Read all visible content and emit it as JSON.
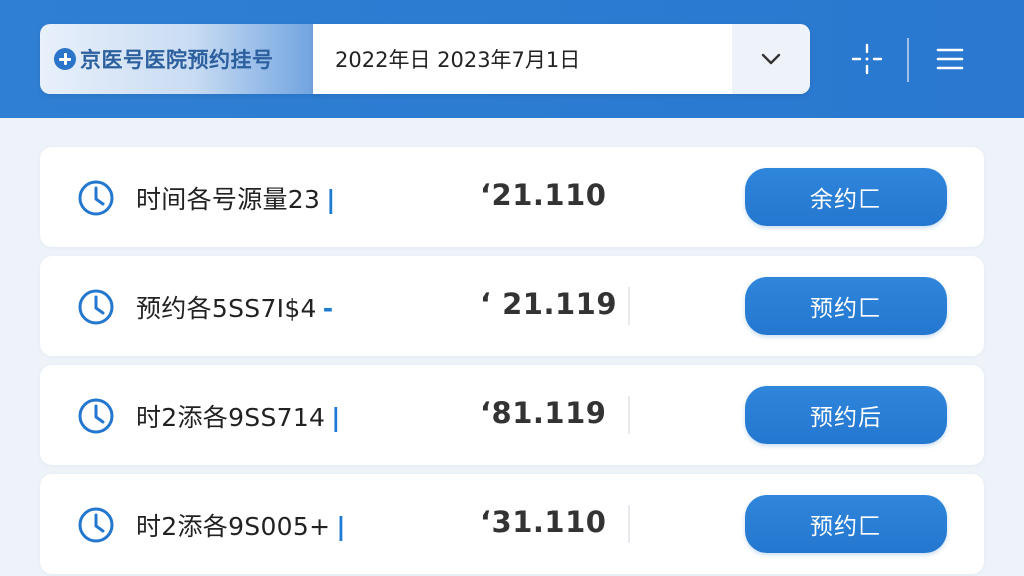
{
  "header": {
    "brand_title": "京医号医院预约挂号",
    "date_range": "2022年日 2023年7月1日",
    "icons": {
      "brand": "plus-circle-icon",
      "dropdown": "chevron-down-icon",
      "scan": "crosshair-icon",
      "menu": "hamburger-menu-icon"
    }
  },
  "rows": [
    {
      "label": "时间各号源量23",
      "accent": "|",
      "value": "‘21.110",
      "button": "余约匚"
    },
    {
      "label": "预约各5SS7I$4",
      "accent": "-",
      "value": "‘ 21.119",
      "button": "预约匚"
    },
    {
      "label": "时2添各9SS714",
      "accent": "|",
      "value": "‘81.119",
      "button": "预约后"
    },
    {
      "label": "时2添各9S005+",
      "accent": "|",
      "value": "‘31.110",
      "button": "预约匚"
    }
  ],
  "colors": {
    "primary": "#2b7bd2",
    "accent_text": "#1e7bd4",
    "background": "#eef3f9"
  }
}
